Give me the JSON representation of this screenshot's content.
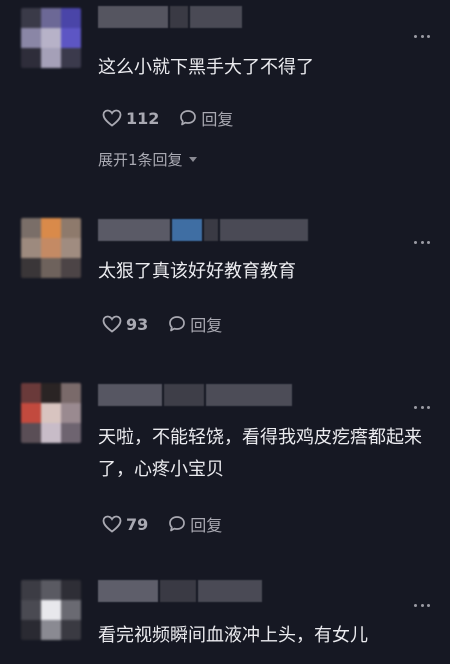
{
  "comments": [
    {
      "text": "这么小就下黑手大了不得了",
      "likes": "112",
      "reply_label": "回复",
      "expand_label": "展开1条回复"
    },
    {
      "text": "太狠了真该好好教育教育",
      "likes": "93",
      "reply_label": "回复"
    },
    {
      "text": "天啦，不能轻饶，看得我鸡皮疙瘩都起来了，心疼小宝贝",
      "likes": "79",
      "reply_label": "回复"
    },
    {
      "text": "看完视频瞬间血液冲上头，有女儿"
    }
  ],
  "colors": {
    "background": "#161823",
    "text": "#ebebef",
    "secondary_text": "#a9a9b2"
  }
}
